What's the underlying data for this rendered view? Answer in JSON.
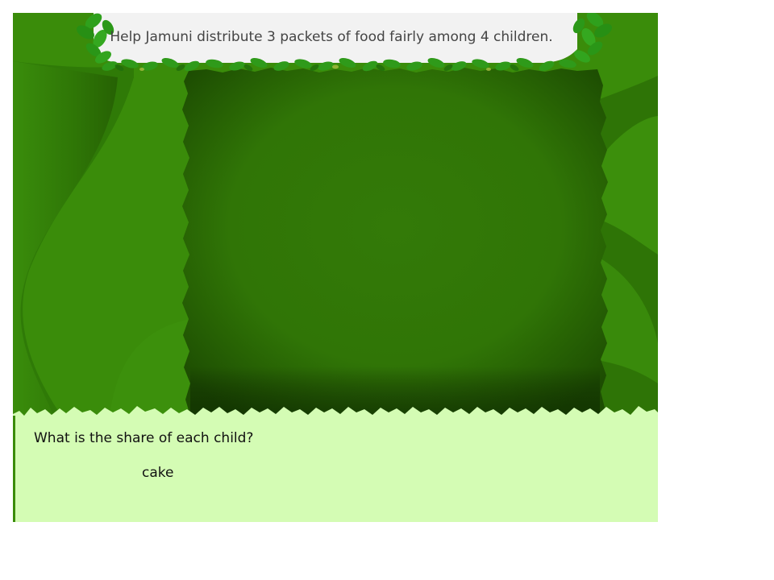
{
  "banner": {
    "instruction": "Help Jamuni distribute 3 packets of food fairly among 4 children."
  },
  "question": {
    "prompt": "What is the share of each child?",
    "answer_unit": "cake"
  },
  "colors": {
    "background_green": "#3a8a0a",
    "dark_green": "#2c6a05",
    "play_area_green": "#327808",
    "banner_bg": "#f2f2f2",
    "question_panel_bg": "#d4fcb4",
    "leaf_green": "#2f9a1a"
  },
  "icons": {
    "banner_corner_left": "leaf-cluster-icon",
    "banner_corner_right": "leaf-cluster-icon",
    "banner_bottom_edge": "leaf-garland-icon"
  }
}
